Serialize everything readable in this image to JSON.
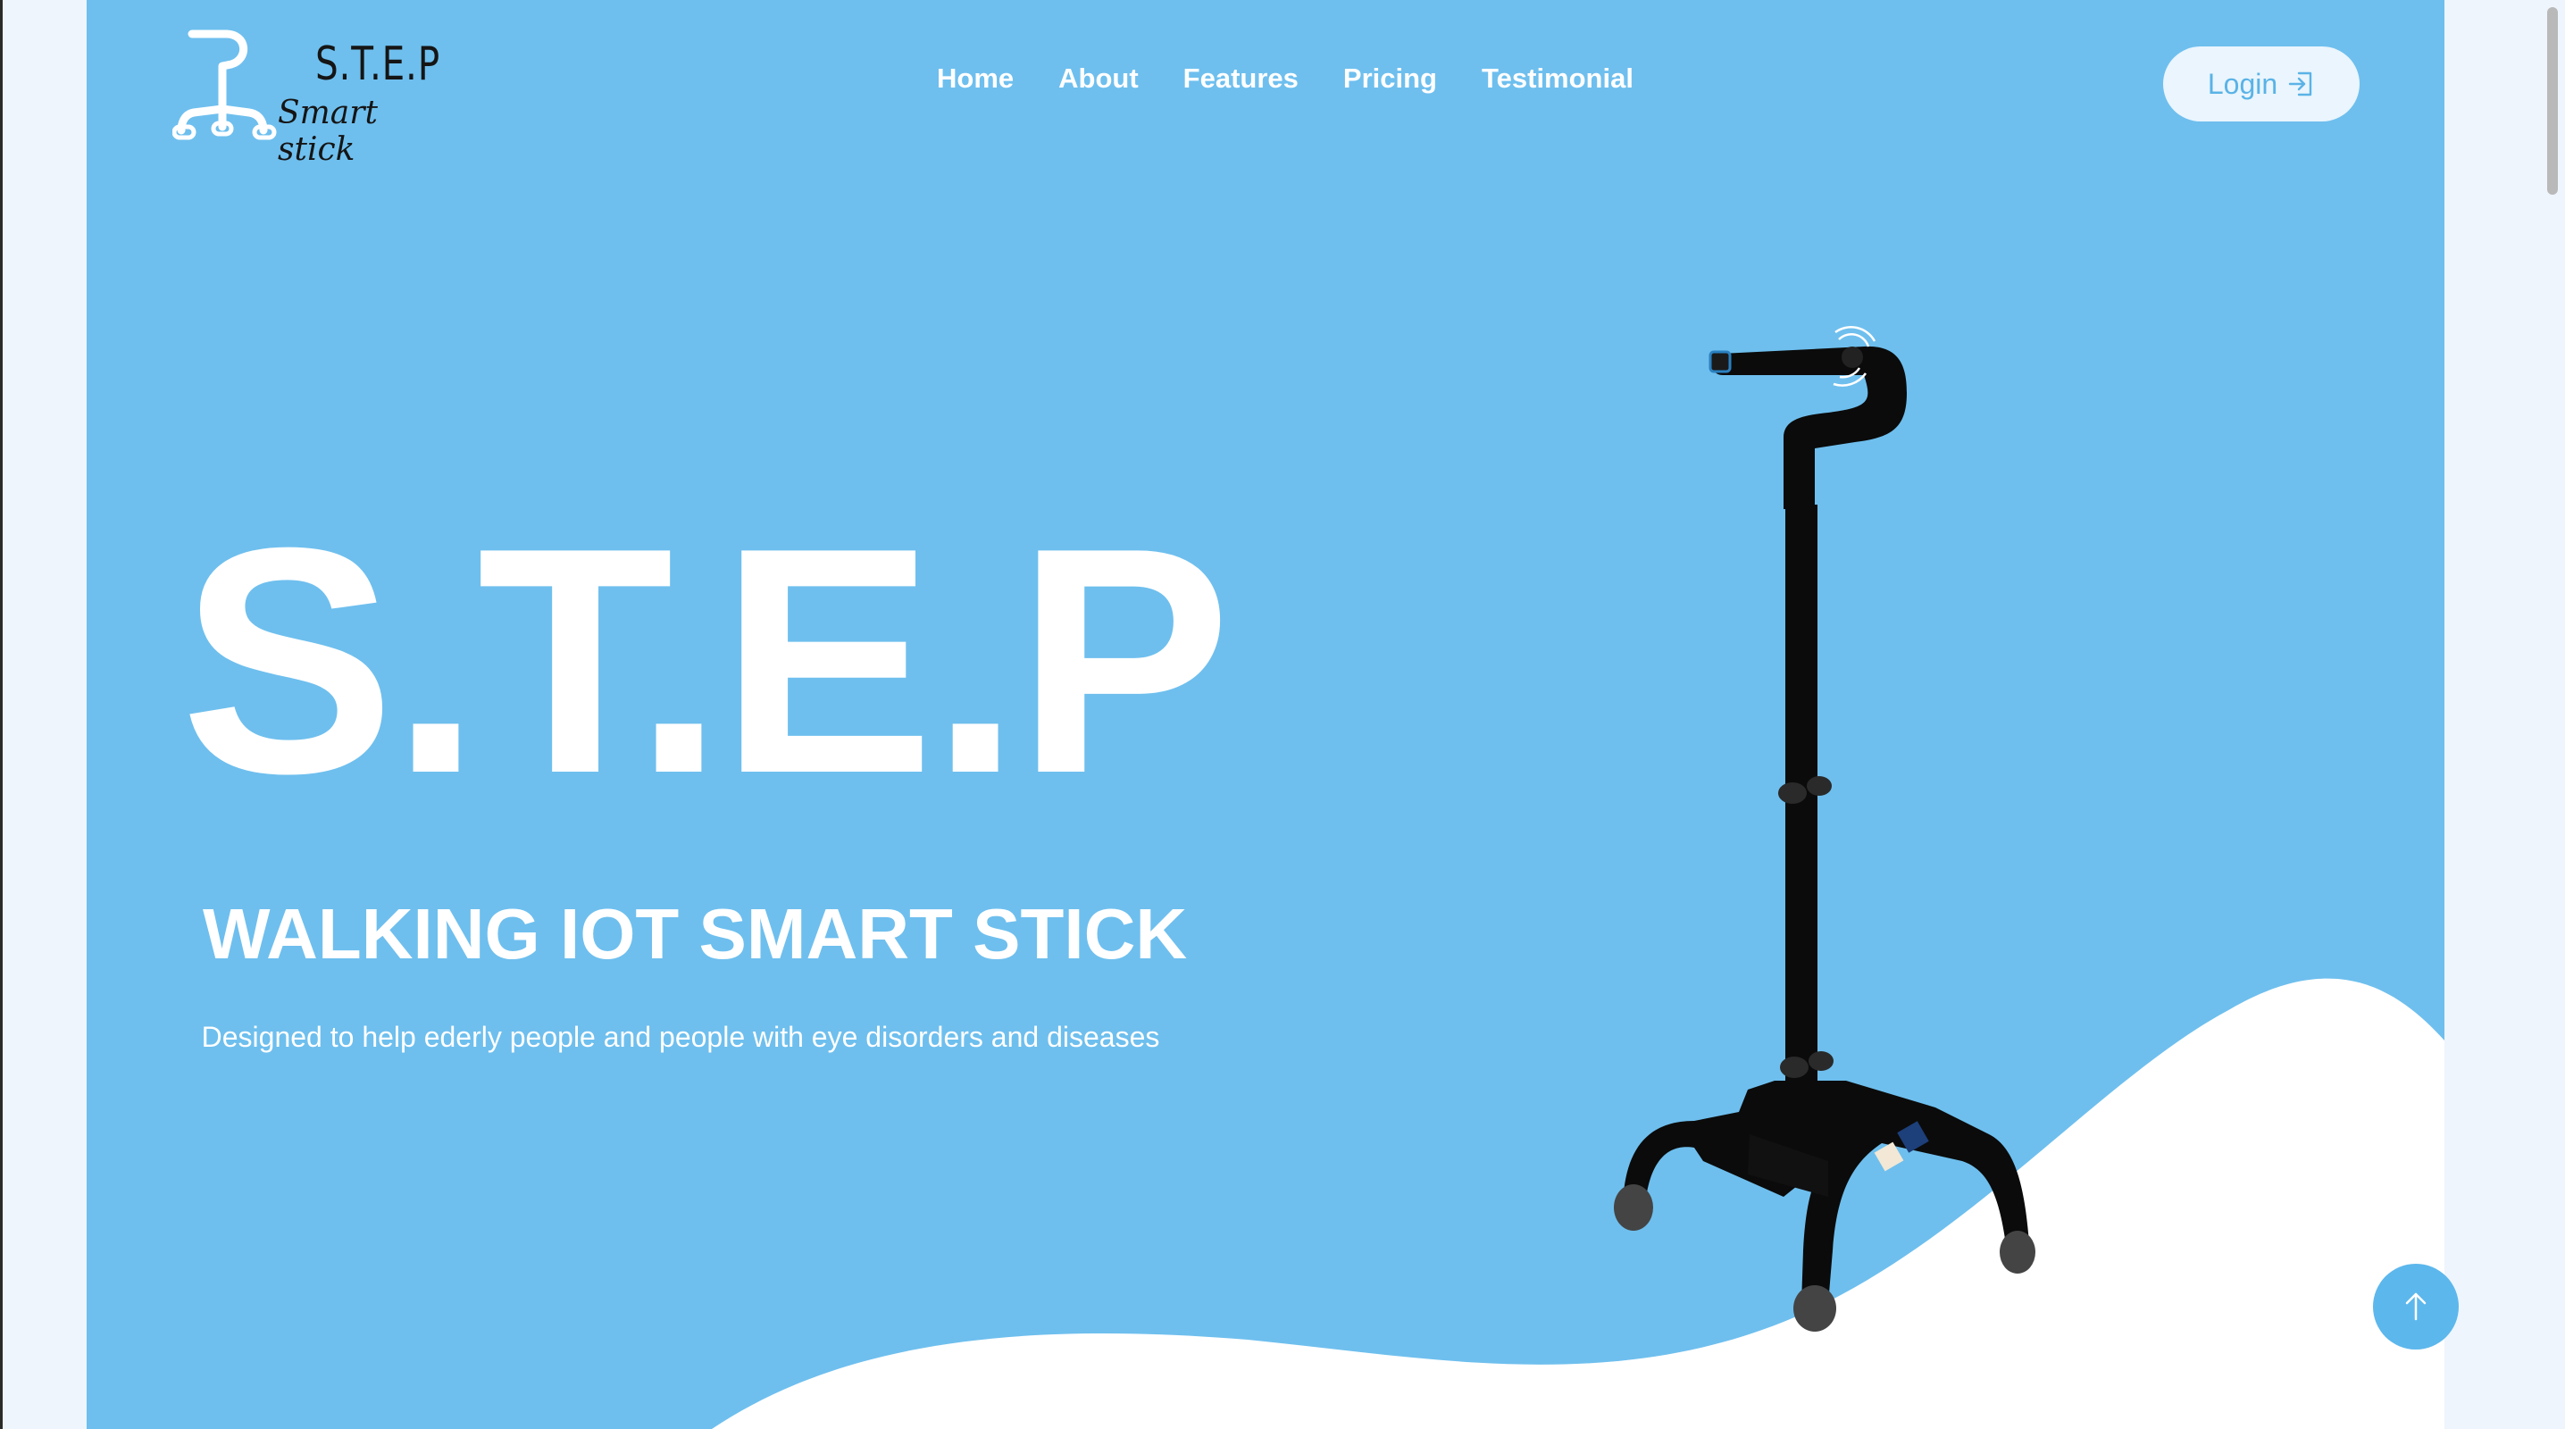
{
  "brand": {
    "title": "S.T.E.P",
    "subtitle": "Smart stick",
    "logo_icon": "cane-icon"
  },
  "nav": {
    "items": [
      "Home",
      "About",
      "Features",
      "Pricing",
      "Testimonial"
    ]
  },
  "login": {
    "label": "Login",
    "icon": "login-arrow-icon"
  },
  "hero": {
    "title": "S.T.E.P",
    "subtitle": "WALKING IOT SMART STICK",
    "description": "Designed to help ederly people and people with eye disorders and diseases",
    "image": "smart-stick-illustration"
  },
  "scroll_top": {
    "icon": "arrow-up-icon"
  },
  "colors": {
    "hero_background": "#6ebfee",
    "page_background": "#eef5fd",
    "wave": "#ffffff",
    "login_text": "#5ab3e6",
    "scroll_button": "#5cb7ec"
  }
}
